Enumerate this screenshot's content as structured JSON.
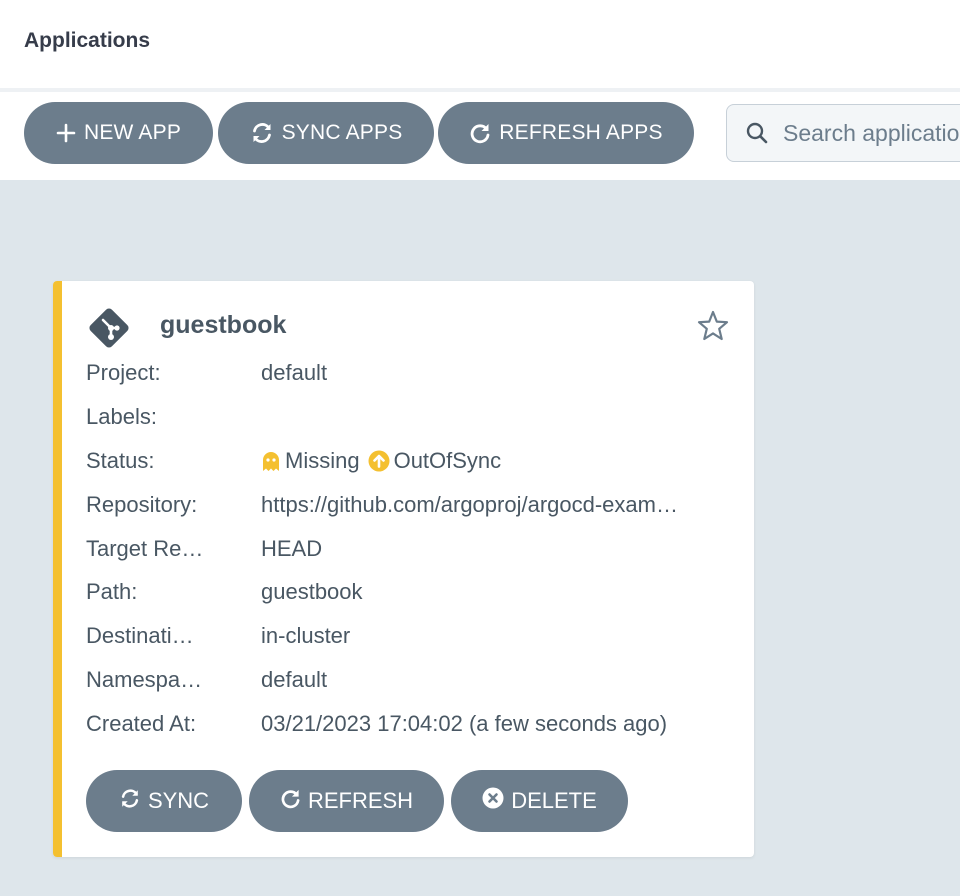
{
  "header": {
    "title": "Applications"
  },
  "toolbar": {
    "new_app": "NEW APP",
    "sync_apps": "SYNC APPS",
    "refresh_apps": "REFRESH APPS",
    "search_placeholder": "Search applications..."
  },
  "app": {
    "name": "guestbook",
    "fields": {
      "project_label": "Project:",
      "project_value": "default",
      "labels_label": "Labels:",
      "labels_value": "",
      "status_label": "Status:",
      "health": "Missing",
      "sync": "OutOfSync",
      "repo_label": "Repository:",
      "repo_value": "https://github.com/argoproj/argocd-exam…",
      "target_label": "Target Re…",
      "target_value": "HEAD",
      "path_label": "Path:",
      "path_value": "guestbook",
      "dest_label": "Destinati…",
      "dest_value": "in-cluster",
      "ns_label": "Namespa…",
      "ns_value": "default",
      "created_label": "Created At:",
      "created_value": "03/21/2023 17:04:02  (a few seconds ago)"
    },
    "buttons": {
      "sync": "SYNC",
      "refresh": "REFRESH",
      "delete": "DELETE"
    }
  },
  "colors": {
    "accent_bar": "#f4c030",
    "button_bg": "#6c7d8c",
    "health_missing": "#f4c030",
    "sync_outofsync": "#f4c030",
    "page_bg": "#dee6eb"
  },
  "icons": {
    "app": "git-diamond-icon",
    "favorite": "star-outline-icon",
    "new_app": "plus-icon",
    "sync": "sync-icon",
    "refresh": "redo-icon",
    "delete": "times-circle-icon",
    "search": "search-icon",
    "health": "ghost-icon",
    "out_of_sync": "arrow-circle-up-icon"
  }
}
